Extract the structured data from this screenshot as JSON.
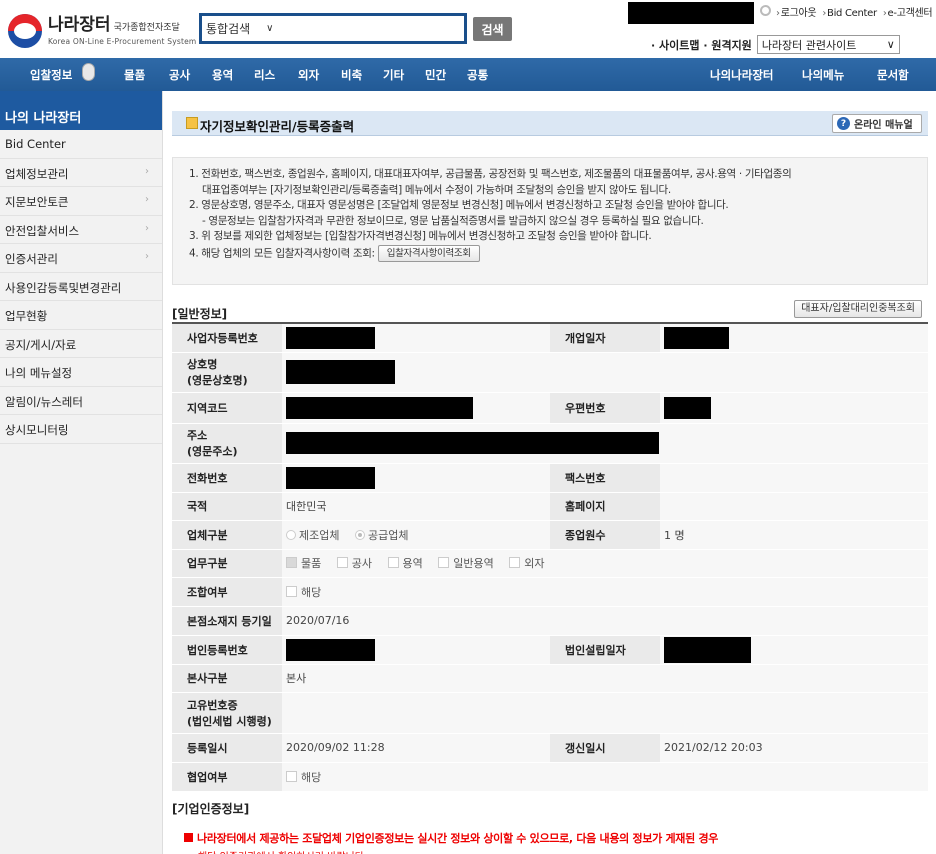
{
  "header": {
    "logo_title": "나라장터",
    "logo_title_small": "국가종합전자조달",
    "logo_sub": "Korea ON-Line E-Procurement System",
    "search_select": "통합검색",
    "search_button": "검색",
    "top_links": [
      "로그아웃",
      "Bid Center",
      "e-고객센터"
    ],
    "util_links": "· 사이트맵 · 원격지원",
    "related_select": "나라장터 관련사이트"
  },
  "nav": {
    "items": [
      "입찰정보",
      "물품",
      "공사",
      "용역",
      "리스",
      "외자",
      "비축",
      "기타",
      "민간",
      "공통"
    ],
    "right_items": [
      "나의나라장터",
      "나의메뉴",
      "문서함"
    ]
  },
  "sidebar": {
    "title": "나의 나라장터",
    "items": [
      {
        "label": "Bid Center",
        "arrow": false
      },
      {
        "label": "업체정보관리",
        "arrow": true
      },
      {
        "label": "지문보안토큰",
        "arrow": true
      },
      {
        "label": "안전입찰서비스",
        "arrow": true
      },
      {
        "label": "인증서관리",
        "arrow": true
      },
      {
        "label": "사용인감등록및변경관리",
        "arrow": false
      },
      {
        "label": "업무현황",
        "arrow": false
      },
      {
        "label": "공지/게시/자료",
        "arrow": false
      },
      {
        "label": "나의 메뉴설정",
        "arrow": false
      },
      {
        "label": "알림이/뉴스레터",
        "arrow": false
      },
      {
        "label": "상시모니터링",
        "arrow": false
      }
    ]
  },
  "page": {
    "title": "자기정보확인관리/등록증출력",
    "manual_button": "온라인 매뉴얼",
    "notice": [
      "1. 전화번호, 팩스번호, 종업원수, 홈페이지, 대표대표자여부, 공급물품, 공장전화 및 팩스번호, 제조물품의 대표물품여부, 공사.용역 · 기타업종의",
      "대표업종여부는 [자기정보확인관리/등록증출력] 메뉴에서 수정이 가능하며 조달청의 승인을 받지 않아도 됩니다.",
      "2. 영문상호명, 영문주소, 대표자 영문성명은 [조달업체 영문정보 변경신청] 메뉴에서 변경신청하고 조달청 승인을 받아야 합니다.",
      "- 영문정보는 입찰참가자격과 무관한 정보이므로, 영문 납품실적증명서를 발급하지 않으실 경우 등록하실 필요 없습니다.",
      "3. 위 정보를 제외한 업체정보는 [입찰참가자격변경신청] 메뉴에서 변경신청하고 조달청 승인을 받아야 합니다.",
      "4. 해당 업체의 모든 입찰자격사항이력 조회:"
    ],
    "history_button": "입찰자격사항이력조회",
    "general_title": "[일반정보]",
    "dup_button": "대표자/입찰대리인중복조회",
    "cert_title": "[기업인증정보]",
    "cert_notice": "나라장터에서 제공하는 조달업체 기업인증정보는 실시간 정보와 상이할 수 있으므로, 다음 내용의 정보가 게재된 경우",
    "cert_cut": "해당 인증기관에서 확인하시기 바랍니다."
  },
  "table": {
    "biz_no": "사업자등록번호",
    "open_date": "개업일자",
    "company_name": "상호명",
    "company_name_en": "(영문상호명)",
    "region_code": "지역코드",
    "postal_code": "우편번호",
    "address": "주소",
    "address_en": "(영문주소)",
    "phone": "전화번호",
    "fax": "팩스번호",
    "country": "국적",
    "country_val": "대한민국",
    "homepage": "홈페이지",
    "biz_type": "업체구분",
    "biz_type_opt1": "제조업체",
    "biz_type_opt2": "공급업체",
    "employees": "종업원수",
    "employees_val": "1 명",
    "work_type": "업무구분",
    "work_opts": [
      "물품",
      "공사",
      "용역",
      "일반용역",
      "외자"
    ],
    "union": "조합여부",
    "union_val": "해당",
    "hq_reg_date": "본점소재지 등기일",
    "hq_reg_date_val": "2020/07/16",
    "corp_no": "법인등록번호",
    "corp_date": "법인설립일자",
    "hq_type": "본사구분",
    "hq_type_val": "본사",
    "unique_no": "고유번호증",
    "unique_no_sub": "(법인세법 시행령)",
    "reg_datetime": "등록일시",
    "reg_datetime_val": "2020/09/02 11:28",
    "update_datetime": "갱신일시",
    "update_datetime_val": "2021/02/12 20:03",
    "coop": "협업여부",
    "coop_val": "해당"
  },
  "colors": {
    "nav_blue": "#225a96",
    "sidebar_title": "#1e5aa0",
    "label_bg": "#eaeaea",
    "notice_red": "#e00000"
  }
}
